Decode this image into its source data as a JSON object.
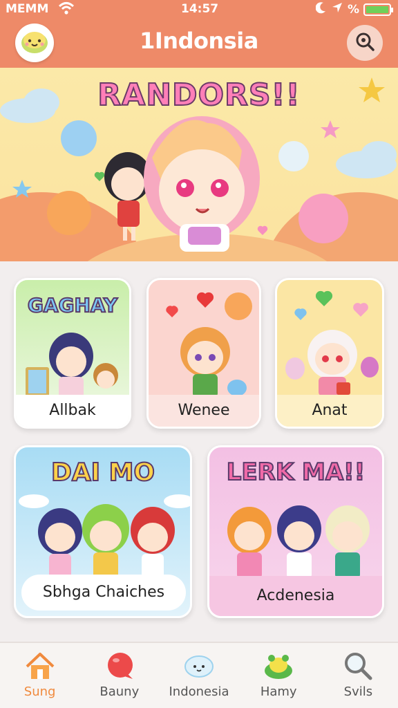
{
  "status_bar": {
    "carrier": "MEMM",
    "time": "14:57",
    "battery_percent_symbol": "%",
    "battery_level": 1.0,
    "icons": [
      "wifi-icon",
      "moon-icon",
      "location-arrow-icon",
      "battery-icon"
    ]
  },
  "header": {
    "title": "1Indonsia",
    "logo_icon": "smiley-face-icon",
    "search_icon": "search-icon"
  },
  "banner": {
    "title": "RANDORS!!"
  },
  "cards": [
    {
      "heading": "GAGHAY",
      "label": "Allbak"
    },
    {
      "heading": "",
      "label": "Wenee"
    },
    {
      "heading": "",
      "label": "Anat"
    },
    {
      "heading": "DAI MO",
      "label": "Sbhga Chaiches"
    },
    {
      "heading": "LERK MA!!",
      "label": "Acdenesia"
    }
  ],
  "bottom_nav": [
    {
      "label": "Sung",
      "icon": "home-icon",
      "active": true
    },
    {
      "label": "Bauny",
      "icon": "chat-bubble-icon",
      "active": false
    },
    {
      "label": "Indonesia",
      "icon": "cloud-face-icon",
      "active": false
    },
    {
      "label": "Hamy",
      "icon": "frog-icon",
      "active": false
    },
    {
      "label": "Svils",
      "icon": "search-icon",
      "active": false
    }
  ],
  "colors": {
    "header": "#ee8a68",
    "banner": "#fbe9a8",
    "active_nav": "#f08a3e",
    "background": "#f2eeee"
  }
}
